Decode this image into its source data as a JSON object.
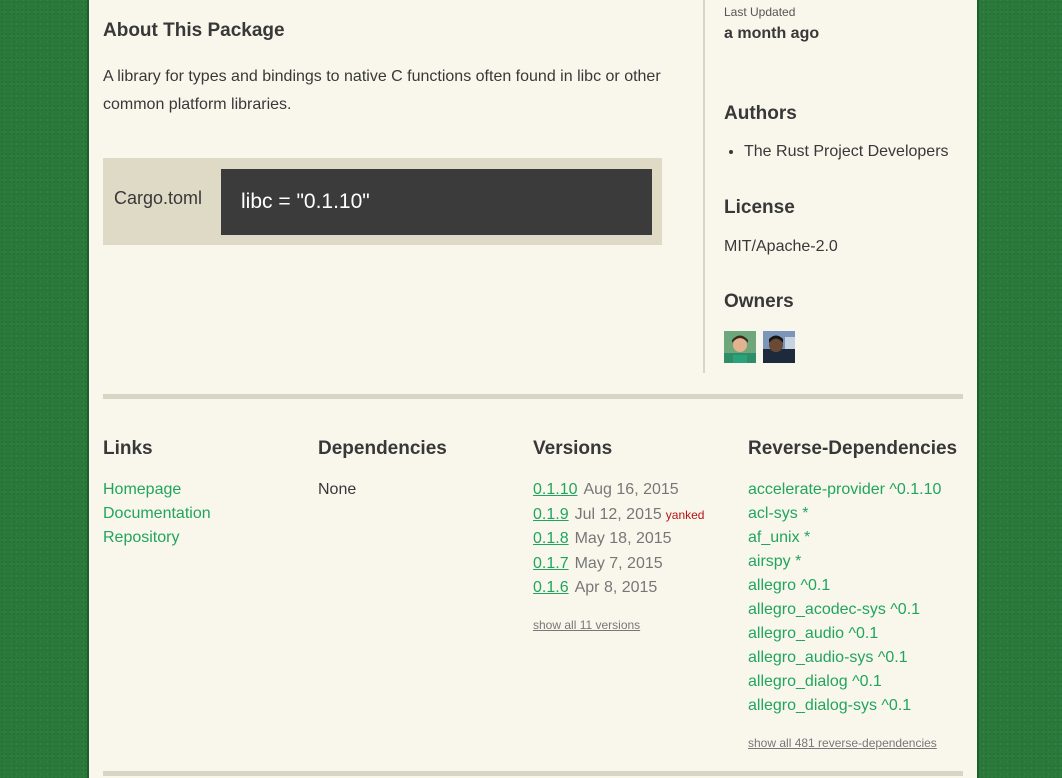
{
  "about": {
    "title": "About This Package",
    "description": "A library for types and bindings to native C functions often found in libc or other common platform libraries."
  },
  "install": {
    "label": "Cargo.toml",
    "code": "libc = \"0.1.10\""
  },
  "meta": {
    "last_updated_label": "Last Updated",
    "last_updated_value": "a month ago",
    "authors_title": "Authors",
    "authors": [
      "The Rust Project Developers"
    ],
    "license_title": "License",
    "license": "MIT/Apache-2.0",
    "owners_title": "Owners"
  },
  "links": {
    "title": "Links",
    "items": [
      "Homepage",
      "Documentation",
      "Repository"
    ]
  },
  "dependencies": {
    "title": "Dependencies",
    "none_text": "None"
  },
  "versions": {
    "title": "Versions",
    "items": [
      {
        "num": "0.1.10",
        "date": "Aug 16, 2015",
        "yanked": ""
      },
      {
        "num": "0.1.9",
        "date": "Jul 12, 2015",
        "yanked": "yanked"
      },
      {
        "num": "0.1.8",
        "date": "May 18, 2015",
        "yanked": ""
      },
      {
        "num": "0.1.7",
        "date": "May 7, 2015",
        "yanked": ""
      },
      {
        "num": "0.1.6",
        "date": "Apr 8, 2015",
        "yanked": ""
      }
    ],
    "show_all": "show all 11 versions"
  },
  "reverse_dependencies": {
    "title": "Reverse-Dependencies",
    "items": [
      "accelerate-provider ^0.1.10",
      "acl-sys *",
      "af_unix *",
      "airspy *",
      "allegro ^0.1",
      "allegro_acodec-sys ^0.1",
      "allegro_audio ^0.1",
      "allegro_audio-sys ^0.1",
      "allegro_dialog ^0.1",
      "allegro_dialog-sys ^0.1"
    ],
    "show_all": "show all 481 reverse-dependencies"
  },
  "colors": {
    "accent": "#21a55e",
    "background": "#2a7a3c",
    "panel": "#f9f7ec",
    "code_bg": "#3b3b3b",
    "yanked": "#b41414"
  }
}
